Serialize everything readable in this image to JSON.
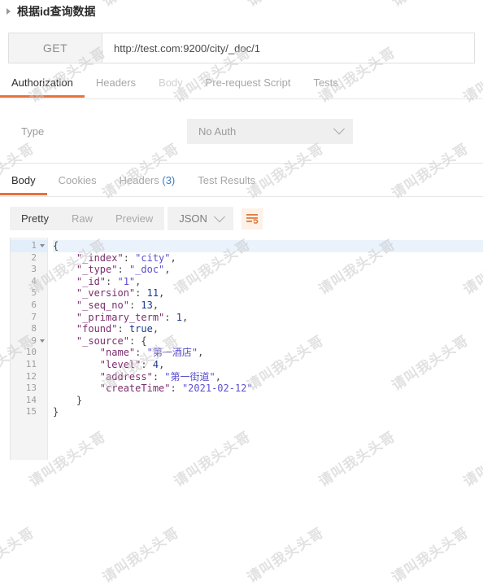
{
  "request": {
    "title": "根据id查询数据",
    "caret_icon": "triangle-right-icon",
    "method": "GET",
    "url": "http://test.com:9200/city/_doc/1",
    "tabs": [
      {
        "label": "Authorization",
        "state": "active"
      },
      {
        "label": "Headers",
        "state": "normal"
      },
      {
        "label": "Body",
        "state": "dim"
      },
      {
        "label": "Pre-request Script",
        "state": "normal"
      },
      {
        "label": "Tests",
        "state": "normal"
      }
    ],
    "auth": {
      "type_label": "Type",
      "selected": "No Auth",
      "chevron_icon": "chevron-down-icon"
    }
  },
  "response": {
    "tabs": [
      {
        "label": "Body",
        "count": "",
        "state": "active"
      },
      {
        "label": "Cookies",
        "count": "",
        "state": "normal"
      },
      {
        "label": "Headers",
        "count": "(3)",
        "state": "normal"
      },
      {
        "label": "Test Results",
        "count": "",
        "state": "normal"
      }
    ],
    "format": {
      "modes": [
        {
          "label": "Pretty",
          "state": "active"
        },
        {
          "label": "Raw",
          "state": "normal"
        },
        {
          "label": "Preview",
          "state": "normal"
        }
      ],
      "type": "JSON",
      "chevron_icon": "chevron-down-icon",
      "wrap_icon": "word-wrap-icon"
    },
    "body_lines": [
      {
        "no": "1",
        "fold": true,
        "highlight": true,
        "tokens": [
          {
            "t": "p",
            "v": "{"
          }
        ]
      },
      {
        "no": "2",
        "fold": false,
        "highlight": false,
        "tokens": [
          {
            "t": "p",
            "v": "    "
          },
          {
            "t": "k",
            "v": "\"_index\""
          },
          {
            "t": "p",
            "v": ": "
          },
          {
            "t": "s",
            "v": "\"city\""
          },
          {
            "t": "p",
            "v": ","
          }
        ]
      },
      {
        "no": "3",
        "fold": false,
        "highlight": false,
        "tokens": [
          {
            "t": "p",
            "v": "    "
          },
          {
            "t": "k",
            "v": "\"_type\""
          },
          {
            "t": "p",
            "v": ": "
          },
          {
            "t": "s",
            "v": "\"_doc\""
          },
          {
            "t": "p",
            "v": ","
          }
        ]
      },
      {
        "no": "4",
        "fold": false,
        "highlight": false,
        "tokens": [
          {
            "t": "p",
            "v": "    "
          },
          {
            "t": "k",
            "v": "\"_id\""
          },
          {
            "t": "p",
            "v": ": "
          },
          {
            "t": "s",
            "v": "\"1\""
          },
          {
            "t": "p",
            "v": ","
          }
        ]
      },
      {
        "no": "5",
        "fold": false,
        "highlight": false,
        "tokens": [
          {
            "t": "p",
            "v": "    "
          },
          {
            "t": "k",
            "v": "\"_version\""
          },
          {
            "t": "p",
            "v": ": "
          },
          {
            "t": "n",
            "v": "11"
          },
          {
            "t": "p",
            "v": ","
          }
        ]
      },
      {
        "no": "6",
        "fold": false,
        "highlight": false,
        "tokens": [
          {
            "t": "p",
            "v": "    "
          },
          {
            "t": "k",
            "v": "\"_seq_no\""
          },
          {
            "t": "p",
            "v": ": "
          },
          {
            "t": "n",
            "v": "13"
          },
          {
            "t": "p",
            "v": ","
          }
        ]
      },
      {
        "no": "7",
        "fold": false,
        "highlight": false,
        "tokens": [
          {
            "t": "p",
            "v": "    "
          },
          {
            "t": "k",
            "v": "\"_primary_term\""
          },
          {
            "t": "p",
            "v": ": "
          },
          {
            "t": "n",
            "v": "1"
          },
          {
            "t": "p",
            "v": ","
          }
        ]
      },
      {
        "no": "8",
        "fold": false,
        "highlight": false,
        "tokens": [
          {
            "t": "p",
            "v": "    "
          },
          {
            "t": "k",
            "v": "\"found\""
          },
          {
            "t": "p",
            "v": ": "
          },
          {
            "t": "b",
            "v": "true"
          },
          {
            "t": "p",
            "v": ","
          }
        ]
      },
      {
        "no": "9",
        "fold": true,
        "highlight": false,
        "tokens": [
          {
            "t": "p",
            "v": "    "
          },
          {
            "t": "k",
            "v": "\"_source\""
          },
          {
            "t": "p",
            "v": ": {"
          }
        ]
      },
      {
        "no": "10",
        "fold": false,
        "highlight": false,
        "tokens": [
          {
            "t": "p",
            "v": "        "
          },
          {
            "t": "k",
            "v": "\"name\""
          },
          {
            "t": "p",
            "v": ": "
          },
          {
            "t": "s",
            "v": "\"第一酒店\""
          },
          {
            "t": "p",
            "v": ","
          }
        ]
      },
      {
        "no": "11",
        "fold": false,
        "highlight": false,
        "tokens": [
          {
            "t": "p",
            "v": "        "
          },
          {
            "t": "k",
            "v": "\"level\""
          },
          {
            "t": "p",
            "v": ": "
          },
          {
            "t": "n",
            "v": "4"
          },
          {
            "t": "p",
            "v": ","
          }
        ]
      },
      {
        "no": "12",
        "fold": false,
        "highlight": false,
        "tokens": [
          {
            "t": "p",
            "v": "        "
          },
          {
            "t": "k",
            "v": "\"address\""
          },
          {
            "t": "p",
            "v": ": "
          },
          {
            "t": "s",
            "v": "\"第一街道\""
          },
          {
            "t": "p",
            "v": ","
          }
        ]
      },
      {
        "no": "13",
        "fold": false,
        "highlight": false,
        "tokens": [
          {
            "t": "p",
            "v": "        "
          },
          {
            "t": "k",
            "v": "\"createTime\""
          },
          {
            "t": "p",
            "v": ": "
          },
          {
            "t": "s",
            "v": "\"2021-02-12\""
          }
        ]
      },
      {
        "no": "14",
        "fold": false,
        "highlight": false,
        "tokens": [
          {
            "t": "p",
            "v": "    }"
          }
        ]
      },
      {
        "no": "15",
        "fold": false,
        "highlight": false,
        "tokens": [
          {
            "t": "p",
            "v": "}"
          }
        ]
      }
    ]
  },
  "watermark": {
    "text": "请叫我头头哥",
    "color": "#c9c9c9"
  },
  "colors": {
    "accent": "#e8713a",
    "link": "#3e7bbf",
    "key": "#7b2d6e",
    "string": "#5a4fcf",
    "number": "#1a3a8f"
  }
}
